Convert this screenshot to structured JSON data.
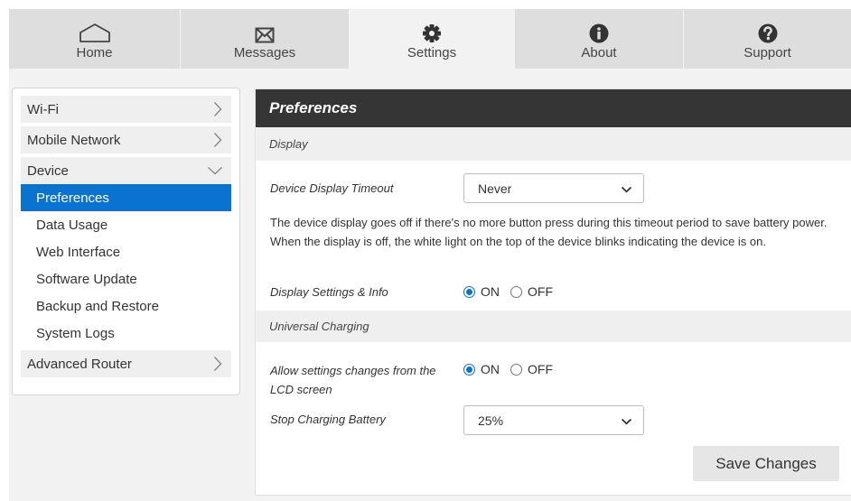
{
  "nav": {
    "tabs": [
      {
        "label": "Home",
        "icon": "home-icon"
      },
      {
        "label": "Messages",
        "icon": "envelope-icon"
      },
      {
        "label": "Settings",
        "icon": "gear-icon"
      },
      {
        "label": "About",
        "icon": "info-icon"
      },
      {
        "label": "Support",
        "icon": "question-icon"
      }
    ],
    "active": "Settings"
  },
  "sidebar": {
    "wifi": "Wi-Fi",
    "mobile_network": "Mobile Network",
    "device": "Device",
    "device_items": [
      "Preferences",
      "Data Usage",
      "Web Interface",
      "Software Update",
      "Backup and Restore",
      "System Logs"
    ],
    "advanced_router": "Advanced Router"
  },
  "panel": {
    "title": "Preferences",
    "display_section": "Display",
    "timeout_label": "Device Display Timeout",
    "timeout_value": "Never",
    "description": "The device display goes off if there's no more button press during this timeout period to save battery power. When the display is off, the white light on the top of the device blinks indicating the device is on.",
    "display_info_label": "Display Settings & Info",
    "on_label": "ON",
    "off_label": "OFF",
    "charging_section": "Universal Charging",
    "lcd_label": "Allow settings changes from the LCD screen",
    "stop_charging_label": "Stop Charging Battery",
    "stop_charging_value": "25%",
    "save_label": "Save Changes"
  },
  "colors": {
    "accent": "#0a73d0",
    "panel_header": "#353535",
    "tab_bar": "#dedede"
  }
}
